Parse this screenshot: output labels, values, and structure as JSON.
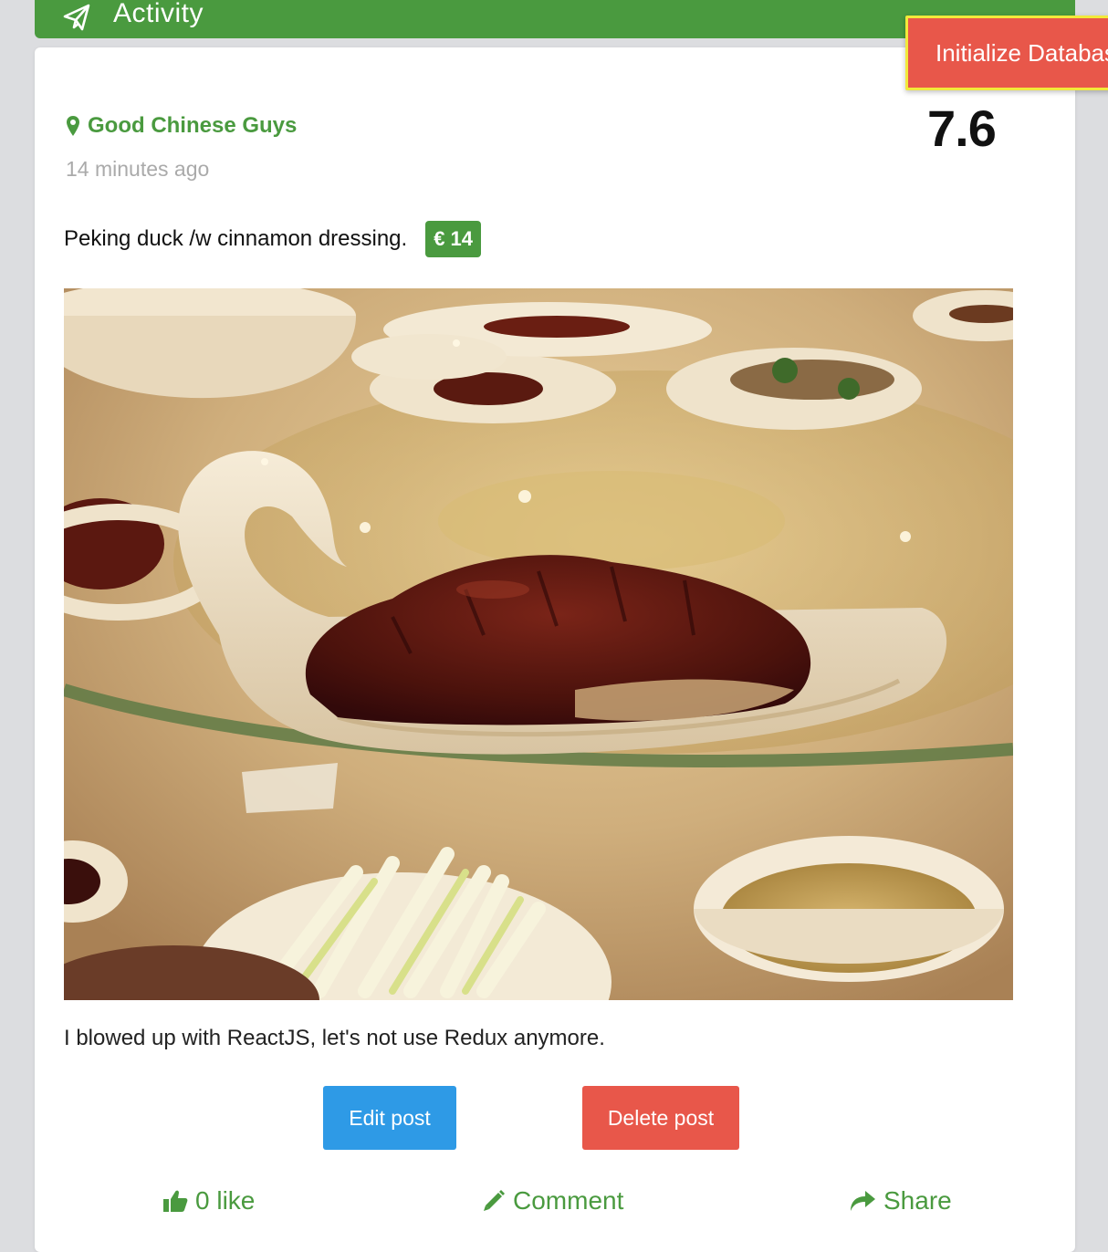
{
  "header": {
    "title": "Activity",
    "icon": "paper-plane-icon"
  },
  "toolbar": {
    "init_db_label": "Initialize Database"
  },
  "post": {
    "location": "Good Chinese Guys",
    "location_icon": "map-pin-icon",
    "timestamp": "14 minutes ago",
    "rating": "7.6",
    "dish_title": "Peking duck /w cinnamon dressing.",
    "price": "€ 14",
    "caption": "I blowed up with ReactJS, let's not use Redux anymore.",
    "edit_label": "Edit post",
    "delete_label": "Delete post"
  },
  "actions": {
    "like_label": "0 like",
    "comment_label": "Comment",
    "share_label": "Share"
  },
  "colors": {
    "brand_green": "#4a9a3f",
    "edit_blue": "#2e9ae6",
    "delete_red": "#e8574a",
    "highlight_yellow": "#f2e93a"
  }
}
